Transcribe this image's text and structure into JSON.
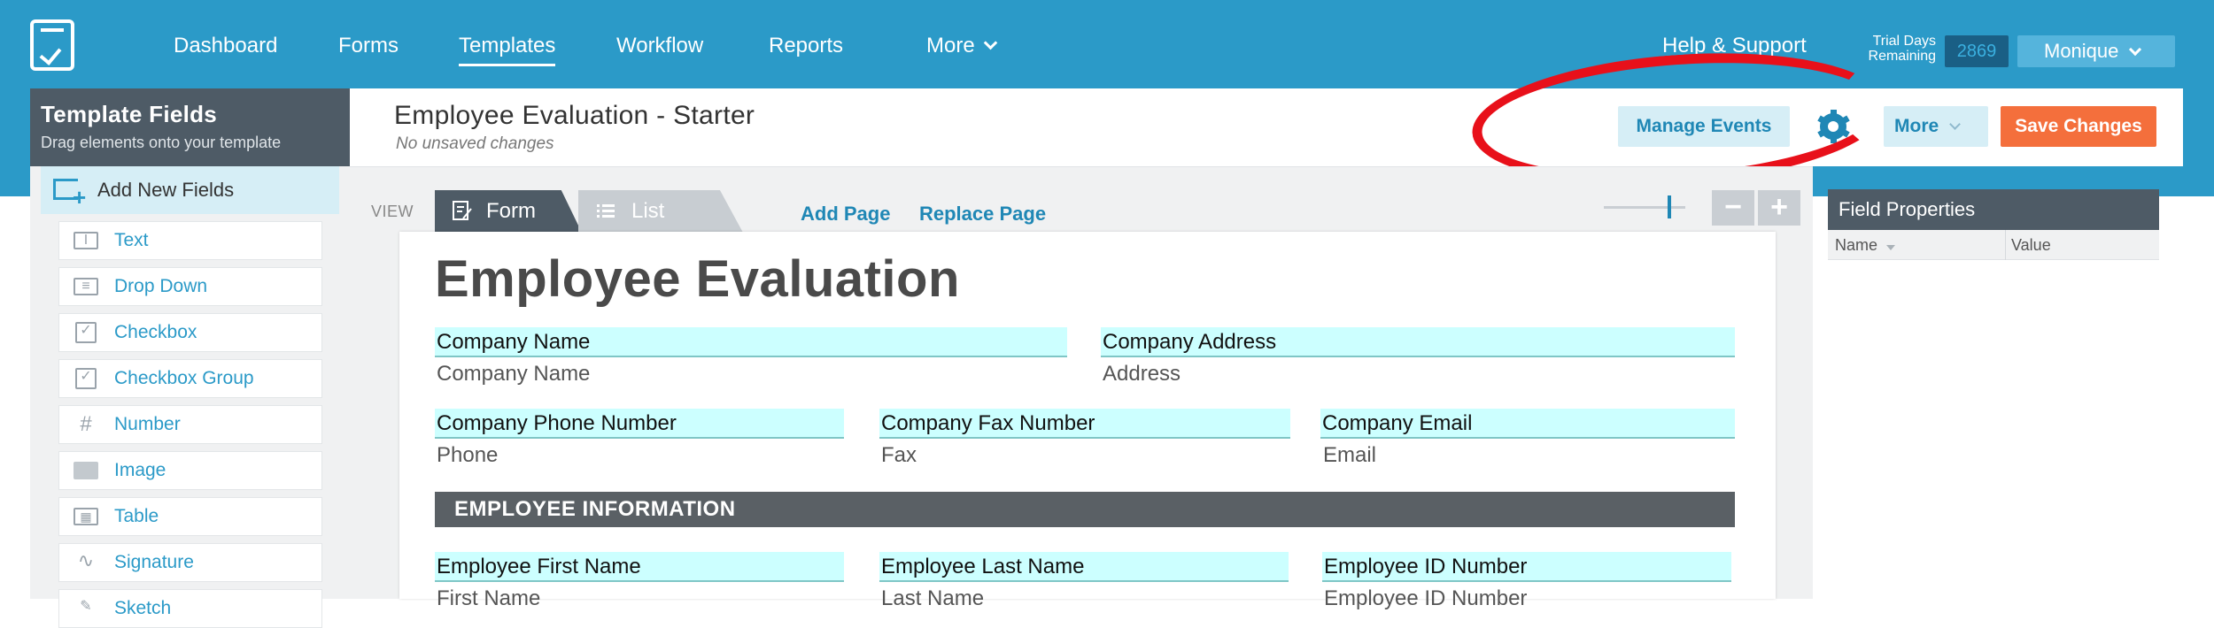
{
  "nav": {
    "items": [
      "Dashboard",
      "Forms",
      "Templates",
      "Workflow",
      "Reports",
      "More"
    ],
    "help": "Help & Support",
    "trial_line1": "Trial Days",
    "trial_line2": "Remaining",
    "trial_count": "2869",
    "user": "Monique"
  },
  "sidebar": {
    "title": "Template Fields",
    "subtitle": "Drag elements onto your template",
    "add_new": "Add New Fields",
    "items": [
      "Text",
      "Drop Down",
      "Checkbox",
      "Checkbox Group",
      "Number",
      "Image",
      "Table",
      "Signature",
      "Sketch"
    ]
  },
  "header": {
    "title": "Employee Evaluation - Starter",
    "status": "No unsaved changes",
    "manage_events": "Manage Events",
    "more": "More",
    "save": "Save Changes"
  },
  "toolbar": {
    "view_label": "VIEW",
    "tab_form": "Form",
    "tab_list": "List",
    "add_page": "Add Page",
    "replace_page": "Replace Page",
    "zoom_out": "−",
    "zoom_in": "+"
  },
  "document": {
    "title": "Employee Evaluation",
    "row1": [
      {
        "label": "Company Name",
        "hint": "Company Name"
      },
      {
        "label": "Company Address",
        "hint": "Address"
      }
    ],
    "row2": [
      {
        "label": "Company Phone Number",
        "hint": "Phone"
      },
      {
        "label": "Company Fax Number",
        "hint": "Fax"
      },
      {
        "label": "Company Email",
        "hint": "Email"
      }
    ],
    "section": "EMPLOYEE INFORMATION",
    "row3": [
      {
        "label": "Employee First Name",
        "hint": "First Name"
      },
      {
        "label": "Employee Last Name",
        "hint": "Last Name"
      },
      {
        "label": "Employee ID Number",
        "hint": "Employee ID Number"
      }
    ]
  },
  "properties": {
    "title": "Field Properties",
    "col_name": "Name",
    "col_value": "Value"
  },
  "colors": {
    "nav_bg": "#2b9ac8",
    "accent": "#1f87b5",
    "save": "#f46f3c",
    "annotation": "#e8101a",
    "field_bg": "#ccffff"
  }
}
